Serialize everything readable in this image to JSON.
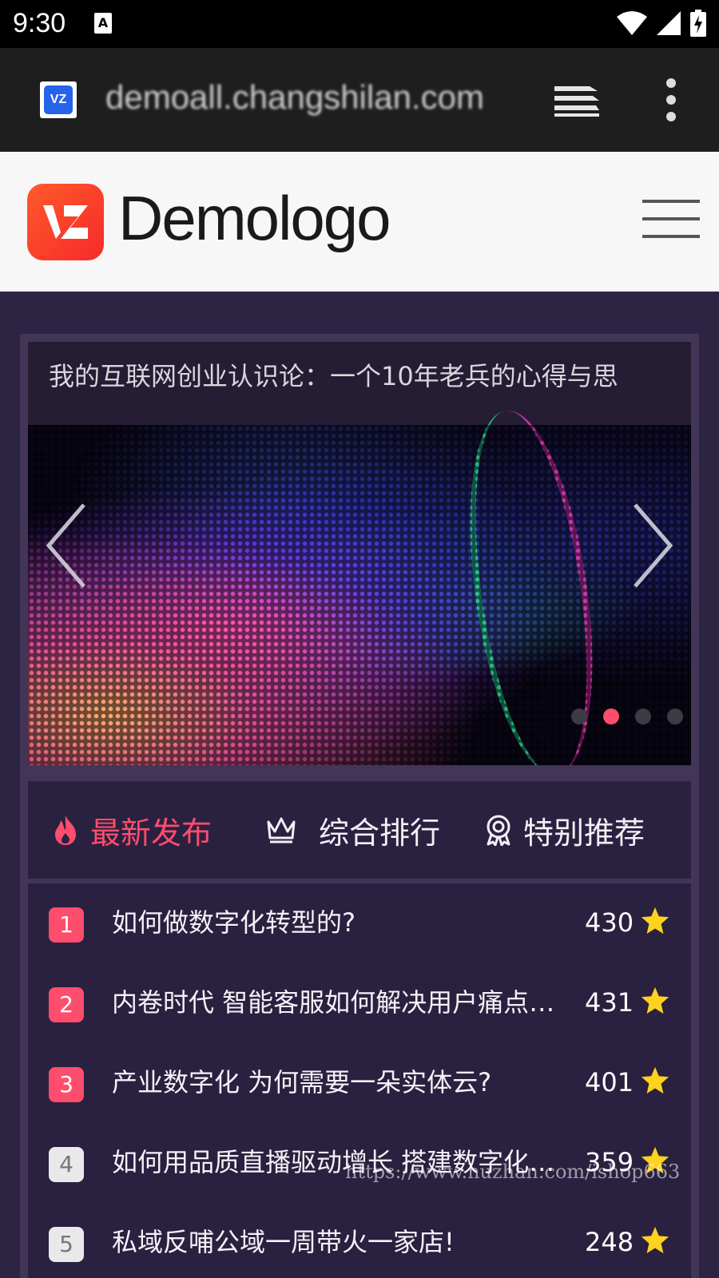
{
  "status_bar": {
    "time": "9:30",
    "notification_icon": "A"
  },
  "browser": {
    "url": "demoall.changshilan.com",
    "favicon_text": "VZ",
    "favicon_icon": "site-favicon-icon",
    "tabs_icon": "tabs-stack-icon",
    "menu_icon": "more-vert-icon"
  },
  "site_header": {
    "logo_text": "Demologo",
    "menu_icon": "hamburger-icon",
    "brand_color": "#ff4a2a"
  },
  "carousel": {
    "title": "我的互联网创业认识论：一个10年老兵的心得与思",
    "active_slide": 2,
    "slide_count": 4,
    "active_dot_color": "#ff4d6d"
  },
  "tabs": [
    {
      "label": "最新发布",
      "icon": "flame-icon",
      "active": true
    },
    {
      "label": "综合排行",
      "icon": "crown-icon",
      "active": false
    },
    {
      "label": "特别推荐",
      "icon": "award-icon",
      "active": false
    }
  ],
  "articles": [
    {
      "rank": "1",
      "title": "如何做数字化转型的?",
      "score": "430"
    },
    {
      "rank": "2",
      "title": "内卷时代 智能客服如何解决用户痛点与商家难点?",
      "score": "431"
    },
    {
      "rank": "3",
      "title": "产业数字化 为何需要一朵实体云?",
      "score": "401"
    },
    {
      "rank": "4",
      "title": "如何用品质直播驱动增长 搭建数字化直播体系",
      "score": "359"
    },
    {
      "rank": "5",
      "title": "私域反哺公域一周带火一家店!",
      "score": "248"
    }
  ],
  "watermark": "https://www.huzhan.com/ishop663",
  "colors": {
    "accent": "#ff4d6d",
    "page_bg": "#2d2443",
    "panel_bg": "#2a2140",
    "star": "#ffd21f"
  }
}
